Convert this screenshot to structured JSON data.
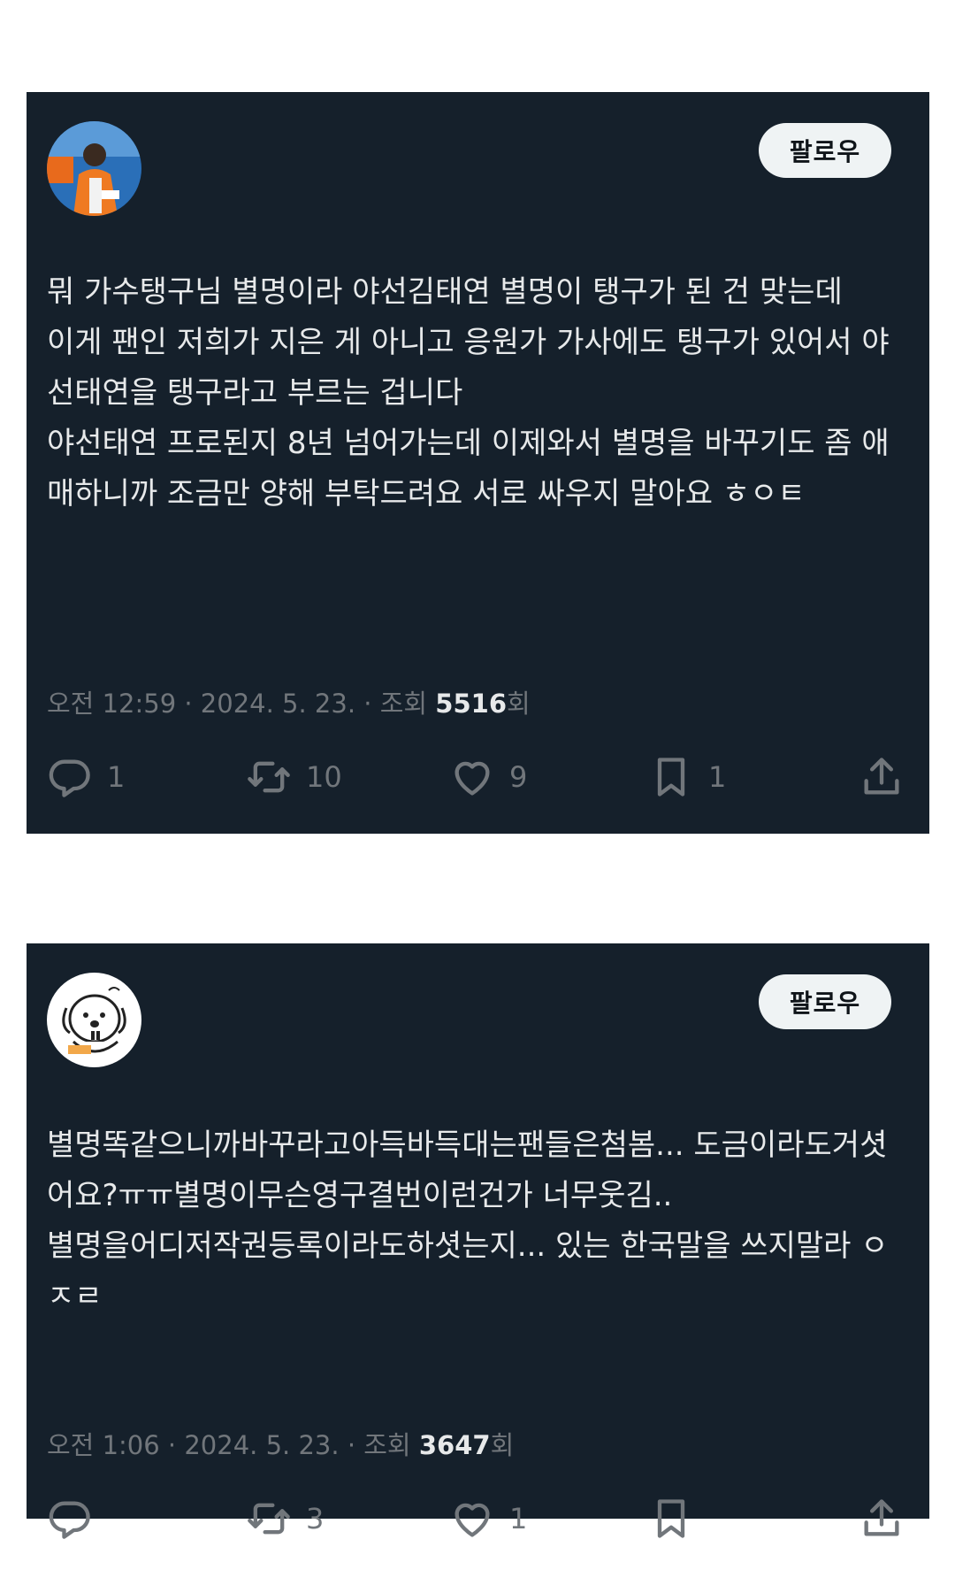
{
  "tweets": [
    {
      "follow_label": "팔로우",
      "text": "뭐 가수탱구님 별명이라 야선김태연 별명이 탱구가 된 건 맞는데\n이게 팬인 저희가 지은 게 아니고 응원가 가사에도 탱구가 있어서 야선태연을 탱구라고 부르는 겁니다\n야선태연 프로된지 8년 넘어가는데 이제와서 별명을 바꾸기도 좀 애매하니까 조금만 양해 부탁드려요 서로 싸우지 말아요 ㅎㅇㅌ",
      "meta_prefix": "오전 12:59 · 2024. 5. 23. · 조회 ",
      "views": "5516",
      "meta_suffix": "회",
      "replies": "1",
      "retweets": "10",
      "likes": "9",
      "bookmarks": "1"
    },
    {
      "follow_label": "팔로우",
      "text": "별명똑같으니까바꾸라고아득바득대는팬들은첨봄... 도금이라도거셧어요?ㅠㅠ별명이무슨영구결번이런건가 너무웃김..\n별명을어디저작권등록이라도하셧는지... 있는 한국말을 쓰지말라 ㅇㅈㄹ",
      "meta_prefix": "오전 1:06 · 2024. 5. 23. · 조회 ",
      "views": "3647",
      "meta_suffix": "회",
      "replies": "",
      "retweets": "3",
      "likes": "1",
      "bookmarks": ""
    }
  ],
  "colors": {
    "card_bg": "#15202b",
    "text": "#e7e9ea",
    "muted": "#71767b",
    "button_bg": "#eff3f4"
  },
  "icons": [
    "reply-icon",
    "retweet-icon",
    "like-icon",
    "bookmark-icon",
    "share-icon"
  ]
}
